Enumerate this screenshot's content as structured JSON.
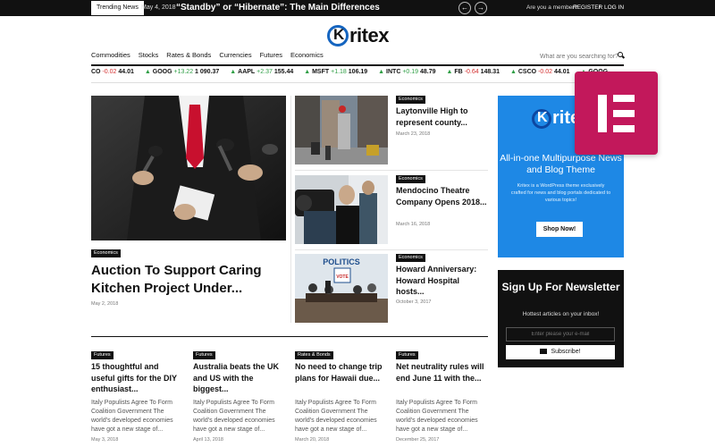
{
  "topbar": {
    "trending_label": "Trending News",
    "trending_date": "May 4, 2018",
    "trending_title": "“Standby” or “Hibernate”: The Main Differences",
    "member_question": "Are you a member?",
    "register_label": "REGISTER",
    "separator": "/",
    "login_label": "LOG IN"
  },
  "brand": {
    "logo_letter": "K",
    "logo_text": "ritex"
  },
  "nav": {
    "items": [
      "Commodities",
      "Stocks",
      "Rates & Bonds",
      "Currencies",
      "Futures",
      "Economics"
    ],
    "search_placeholder": "What are you searching for?"
  },
  "ticker": [
    {
      "symbol": "CO",
      "change": "-0.02",
      "price": "44.01",
      "dir": "down"
    },
    {
      "symbol": "GOOG",
      "change": "+13.22",
      "price": "1 090.37",
      "dir": "up"
    },
    {
      "symbol": "AAPL",
      "change": "+2.37",
      "price": "155.44",
      "dir": "up"
    },
    {
      "symbol": "MSFT",
      "change": "+1.18",
      "price": "106.19",
      "dir": "up"
    },
    {
      "symbol": "INTC",
      "change": "+0.19",
      "price": "48.79",
      "dir": "up"
    },
    {
      "symbol": "FB",
      "change": "-0.64",
      "price": "148.31",
      "dir": "down"
    },
    {
      "symbol": "CSCO",
      "change": "-0.02",
      "price": "44.01",
      "dir": "down"
    },
    {
      "symbol": "GOOG",
      "change": "",
      "price": "",
      "dir": "up"
    }
  ],
  "featured": {
    "category": "Economics",
    "title": "Auction To Support Caring Kitchen Project Under...",
    "date": "May 2, 2018"
  },
  "side_posts": [
    {
      "category": "Economics",
      "title": "Laytonville High to represent county...",
      "date": "March 23, 2018"
    },
    {
      "category": "Economics",
      "title": "Mendocino Theatre Company Opens 2018...",
      "date": "March 16, 2018"
    },
    {
      "category": "Economics",
      "title": "Howard Anniversary: Howard Hospital hosts...",
      "date": "October 3, 2017"
    }
  ],
  "image_text": {
    "politics": "POLITICS",
    "vote": "VOTE"
  },
  "grid_posts": [
    {
      "category": "Futures",
      "title": "15 thoughtful and useful gifts for the DIY enthusiast...",
      "excerpt": "Italy Populists Agree To Form Coalition Government The world's developed economies have got a new stage of...",
      "date": "May 3, 2018"
    },
    {
      "category": "Futures",
      "title": "Australia beats the UK and US with the biggest...",
      "excerpt": "Italy Populists Agree To Form Coalition Government The world's developed economies have got a new stage of...",
      "date": "April 13, 2018"
    },
    {
      "category": "Rates & Bonds",
      "title": "No need to change trip plans for Hawaii due...",
      "excerpt": "Italy Populists Agree To Form Coalition Government The world's developed economies have got a new stage of...",
      "date": "March 20, 2018"
    },
    {
      "category": "Futures",
      "title": "Net neutrality rules will end June 11 with the...",
      "excerpt": "Italy Populists Agree To Form Coalition Government The world's developed economies have got a new stage of...",
      "date": "December 25, 2017"
    }
  ],
  "promo": {
    "logo_letter": "K",
    "logo_text": "rite",
    "heading": "All-in-one Multipurpose News and Blog Theme",
    "text": "Kritex is a WordPress theme exclusively crafted for news and blog portals dedicated to various topics!",
    "button": "Shop Now!"
  },
  "newsletter": {
    "heading": "Sign Up For Newsletter",
    "subtext": "Hottest articles on your inbox!",
    "email_placeholder": "Enter please your e-mail",
    "button": "Subscribe!"
  },
  "colors": {
    "accent": "#1e88e5",
    "elementor": "#c2185b",
    "up": "#2e9e44",
    "down": "#d32f2f"
  },
  "icons": [
    "arrow-left-icon",
    "arrow-right-icon",
    "search-icon",
    "mail-icon",
    "elementor-icon"
  ]
}
